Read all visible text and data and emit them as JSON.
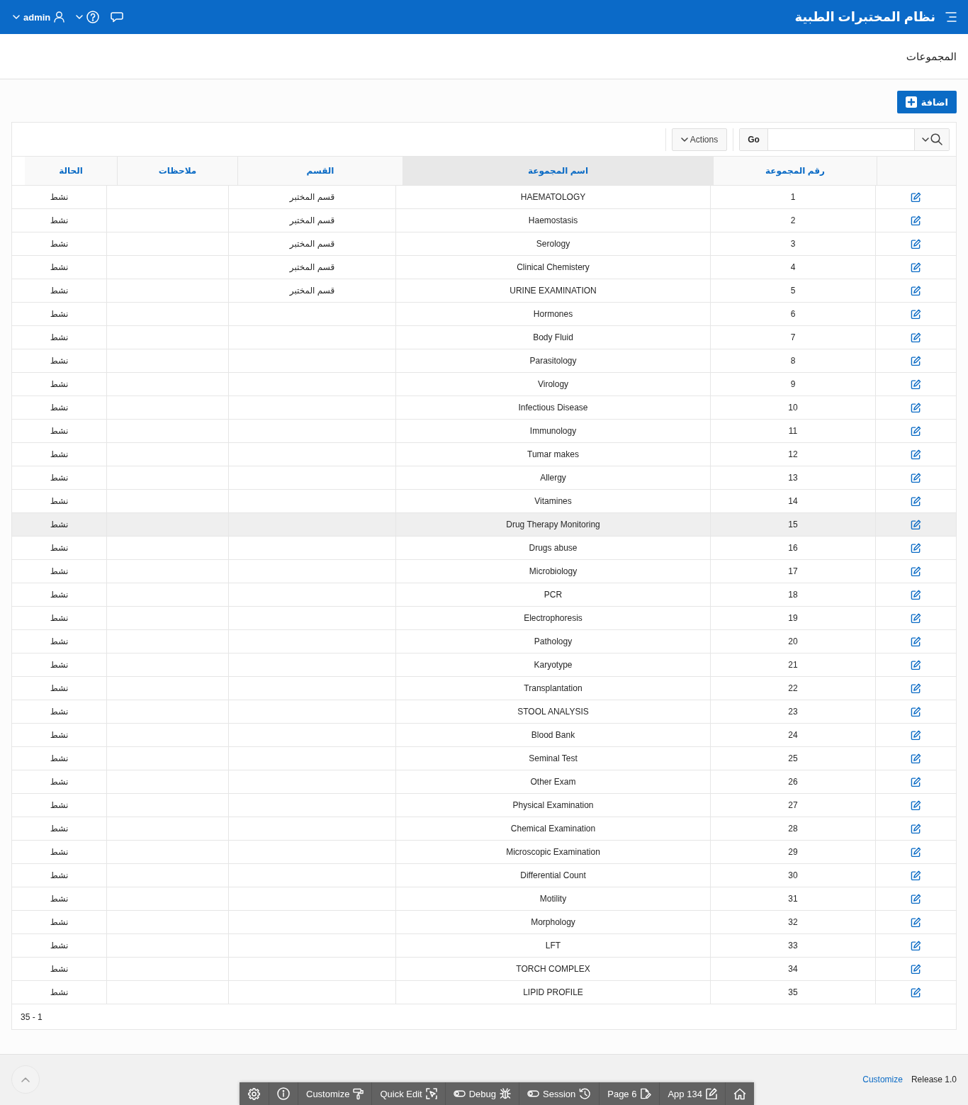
{
  "header": {
    "title": "نظام المختبرات الطبية",
    "user": "admin"
  },
  "page_title": "المجموعات",
  "add_button": "اضافة",
  "report": {
    "go_button": "Go",
    "actions_button": "Actions",
    "columns": [
      {
        "label": "رقم المجموعة",
        "highlighted": false
      },
      {
        "label": "اسم المجموعة",
        "highlighted": true
      },
      {
        "label": "القسم",
        "highlighted": false
      },
      {
        "label": "ملاحظات",
        "highlighted": false
      },
      {
        "label": "الحالة",
        "highlighted": false
      }
    ],
    "rows": [
      {
        "number": "1",
        "name": "HAEMATOLOGY",
        "section": "قسم المختبر",
        "status": "نشط",
        "hovered": false
      },
      {
        "number": "2",
        "name": "Haemostasis",
        "section": "قسم المختبر",
        "status": "نشط",
        "hovered": false
      },
      {
        "number": "3",
        "name": "Serology",
        "section": "قسم المختبر",
        "status": "نشط",
        "hovered": false
      },
      {
        "number": "4",
        "name": "Clinical Chemistery",
        "section": "قسم المختبر",
        "status": "نشط",
        "hovered": false
      },
      {
        "number": "5",
        "name": "URINE EXAMINATION",
        "section": "قسم المختبر",
        "status": "نشط",
        "hovered": false
      },
      {
        "number": "6",
        "name": "Hormones",
        "status": "نشط",
        "hovered": false
      },
      {
        "number": "7",
        "name": "Body Fluid",
        "status": "نشط",
        "hovered": false
      },
      {
        "number": "8",
        "name": "Parasitology",
        "status": "نشط",
        "hovered": false
      },
      {
        "number": "9",
        "name": "Virology",
        "status": "نشط",
        "hovered": false
      },
      {
        "number": "10",
        "name": "Infectious Disease",
        "status": "نشط",
        "hovered": false
      },
      {
        "number": "11",
        "name": "Immunology",
        "status": "نشط",
        "hovered": false
      },
      {
        "number": "12",
        "name": "Tumar makes",
        "status": "نشط",
        "hovered": false
      },
      {
        "number": "13",
        "name": "Allergy",
        "status": "نشط",
        "hovered": false
      },
      {
        "number": "14",
        "name": "Vitamines",
        "status": "نشط",
        "hovered": false
      },
      {
        "number": "15",
        "name": "Drug Therapy Monitoring",
        "status": "نشط",
        "hovered": true
      },
      {
        "number": "16",
        "name": "Drugs abuse",
        "status": "نشط",
        "hovered": false
      },
      {
        "number": "17",
        "name": "Microbiology",
        "status": "نشط",
        "hovered": false
      },
      {
        "number": "18",
        "name": "PCR",
        "status": "نشط",
        "hovered": false
      },
      {
        "number": "19",
        "name": "Electrophoresis",
        "status": "نشط",
        "hovered": false
      },
      {
        "number": "20",
        "name": "Pathology",
        "status": "نشط",
        "hovered": false
      },
      {
        "number": "21",
        "name": "Karyotype",
        "status": "نشط",
        "hovered": false
      },
      {
        "number": "22",
        "name": "Transplantation",
        "status": "نشط",
        "hovered": false
      },
      {
        "number": "23",
        "name": "STOOL ANALYSIS",
        "status": "نشط",
        "hovered": false
      },
      {
        "number": "24",
        "name": "Blood Bank",
        "status": "نشط",
        "hovered": false
      },
      {
        "number": "25",
        "name": "Seminal Test",
        "status": "نشط",
        "hovered": false
      },
      {
        "number": "26",
        "name": "Other Exam",
        "status": "نشط",
        "hovered": false
      },
      {
        "number": "27",
        "name": "Physical Examination",
        "status": "نشط",
        "hovered": false
      },
      {
        "number": "28",
        "name": "Chemical Examination",
        "status": "نشط",
        "hovered": false
      },
      {
        "number": "29",
        "name": "Microscopic Examination",
        "status": "نشط",
        "hovered": false
      },
      {
        "number": "30",
        "name": "Differential Count",
        "status": "نشط",
        "hovered": false
      },
      {
        "number": "31",
        "name": "Motility",
        "status": "نشط",
        "hovered": false
      },
      {
        "number": "32",
        "name": "Morphology",
        "status": "نشط",
        "hovered": false
      },
      {
        "number": "33",
        "name": "LFT",
        "status": "نشط",
        "hovered": false
      },
      {
        "number": "34",
        "name": "TORCH COMPLEX",
        "status": "نشط",
        "hovered": false
      },
      {
        "number": "35",
        "name": "LIPID PROFILE",
        "status": "نشط",
        "hovered": false
      }
    ],
    "pagination": "35 - 1"
  },
  "footer": {
    "release": "Release 1.0",
    "customize_link": "Customize"
  },
  "dev_toolbar": [
    {
      "kind": "home"
    },
    {
      "kind": "app",
      "label": "App 134"
    },
    {
      "kind": "page",
      "label": "Page 6"
    },
    {
      "kind": "session",
      "label": "Session"
    },
    {
      "kind": "debug",
      "label": "Debug"
    },
    {
      "kind": "quickedit",
      "label": "Quick Edit"
    },
    {
      "kind": "customize",
      "label": "Customize"
    },
    {
      "kind": "info"
    },
    {
      "kind": "settings"
    }
  ]
}
